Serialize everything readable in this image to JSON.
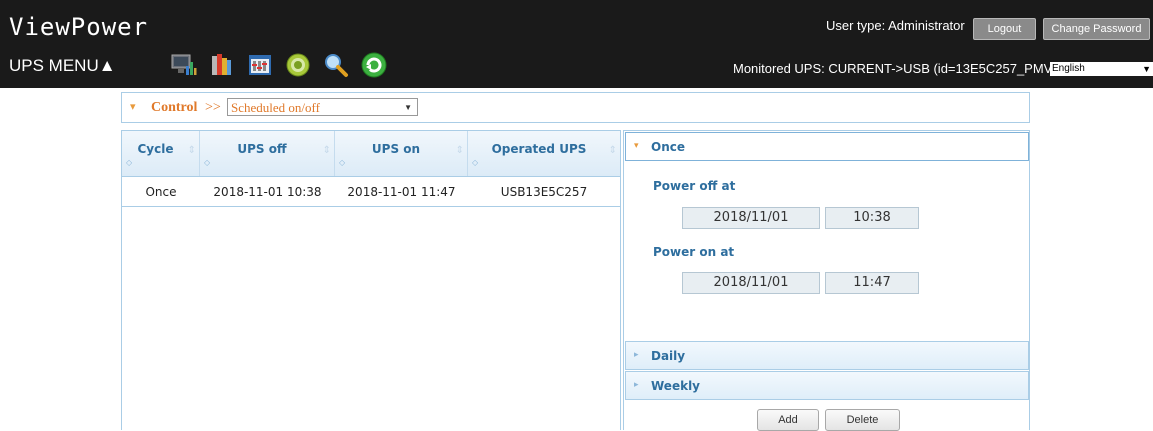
{
  "header": {
    "app_title": "ViewPower",
    "ups_menu_label": "UPS MENU▲",
    "user_type": "User type: Administrator",
    "logout_label": "Logout",
    "change_password_label": "Change Password",
    "monitored_ups": "Monitored UPS: CURRENT->USB (id=13E5C257_PMV)",
    "language_selected": "English",
    "toolbar_icons": [
      "monitor-chart-icon",
      "books-icon",
      "settings-panel-icon",
      "power-button-icon",
      "search-icon",
      "refresh-icon"
    ]
  },
  "control": {
    "label": "Control",
    "separator": ">>",
    "selected_option": "Scheduled on/off"
  },
  "table": {
    "columns": [
      "Cycle",
      "UPS off",
      "UPS on",
      "Operated UPS"
    ],
    "rows": [
      [
        "Once",
        "2018-11-01 10:38",
        "2018-11-01 11:47",
        "USB13E5C257"
      ]
    ]
  },
  "schedule": {
    "once_label": "Once",
    "power_off_label": "Power off at",
    "power_off_date": "2018/11/01",
    "power_off_time": "10:38",
    "power_on_label": "Power on at",
    "power_on_date": "2018/11/01",
    "power_on_time": "11:47",
    "daily_label": "Daily",
    "weekly_label": "Weekly",
    "add_label": "Add",
    "delete_label": "Delete"
  },
  "colors": {
    "header_bg": "#1a1a1a",
    "accent_orange": "#e0792a",
    "label_blue": "#2e6e9e",
    "border_blue": "#aacde6"
  }
}
